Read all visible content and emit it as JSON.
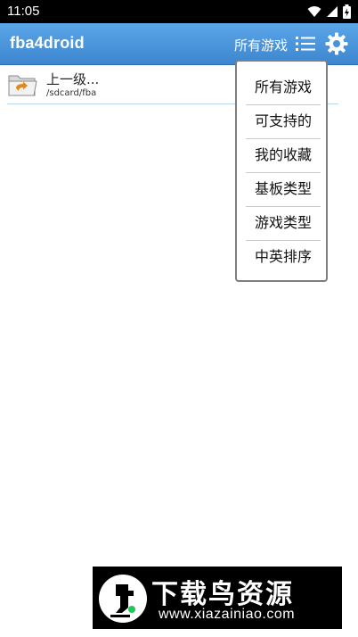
{
  "status_bar": {
    "time": "11:05"
  },
  "app_bar": {
    "title": "fba4droid",
    "filter_label": "所有游戏"
  },
  "file_list": [
    {
      "name": "上一级...",
      "path": "/sdcard/fba"
    }
  ],
  "dropdown": {
    "items": [
      "所有游戏",
      "可支持的",
      "我的收藏",
      "基板类型",
      "游戏类型",
      "中英排序"
    ]
  },
  "watermark": {
    "title": "下载鸟资源",
    "url": "www.xiazainiao.com"
  },
  "colors": {
    "app_bar": "#4a96dc",
    "status_bar": "#000000",
    "divider": "#b8d6ef"
  }
}
